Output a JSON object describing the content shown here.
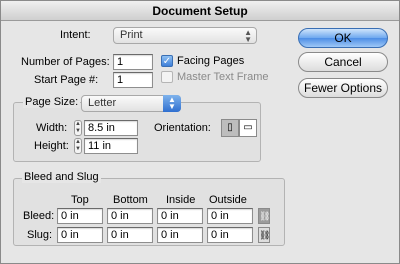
{
  "window": {
    "title": "Document Setup"
  },
  "intent": {
    "label": "Intent:",
    "value": "Print"
  },
  "pages": {
    "number_label": "Number of Pages:",
    "number_value": "1",
    "start_label": "Start Page #:",
    "start_value": "1",
    "facing_label": "Facing Pages",
    "facing_checked": true,
    "master_label": "Master Text Frame",
    "master_checked": false
  },
  "buttons": {
    "ok": "OK",
    "cancel": "Cancel",
    "fewer": "Fewer Options"
  },
  "page_size": {
    "label": "Page Size:",
    "value": "Letter",
    "width_label": "Width:",
    "width_value": "8.5 in",
    "height_label": "Height:",
    "height_value": "11 in",
    "orientation_label": "Orientation:"
  },
  "bleed_slug": {
    "title": "Bleed and Slug",
    "columns": [
      "Top",
      "Bottom",
      "Inside",
      "Outside"
    ],
    "bleed_label": "Bleed:",
    "bleed_values": [
      "0 in",
      "0 in",
      "0 in",
      "0 in"
    ],
    "slug_label": "Slug:",
    "slug_values": [
      "0 in",
      "0 in",
      "0 in",
      "0 in"
    ]
  }
}
